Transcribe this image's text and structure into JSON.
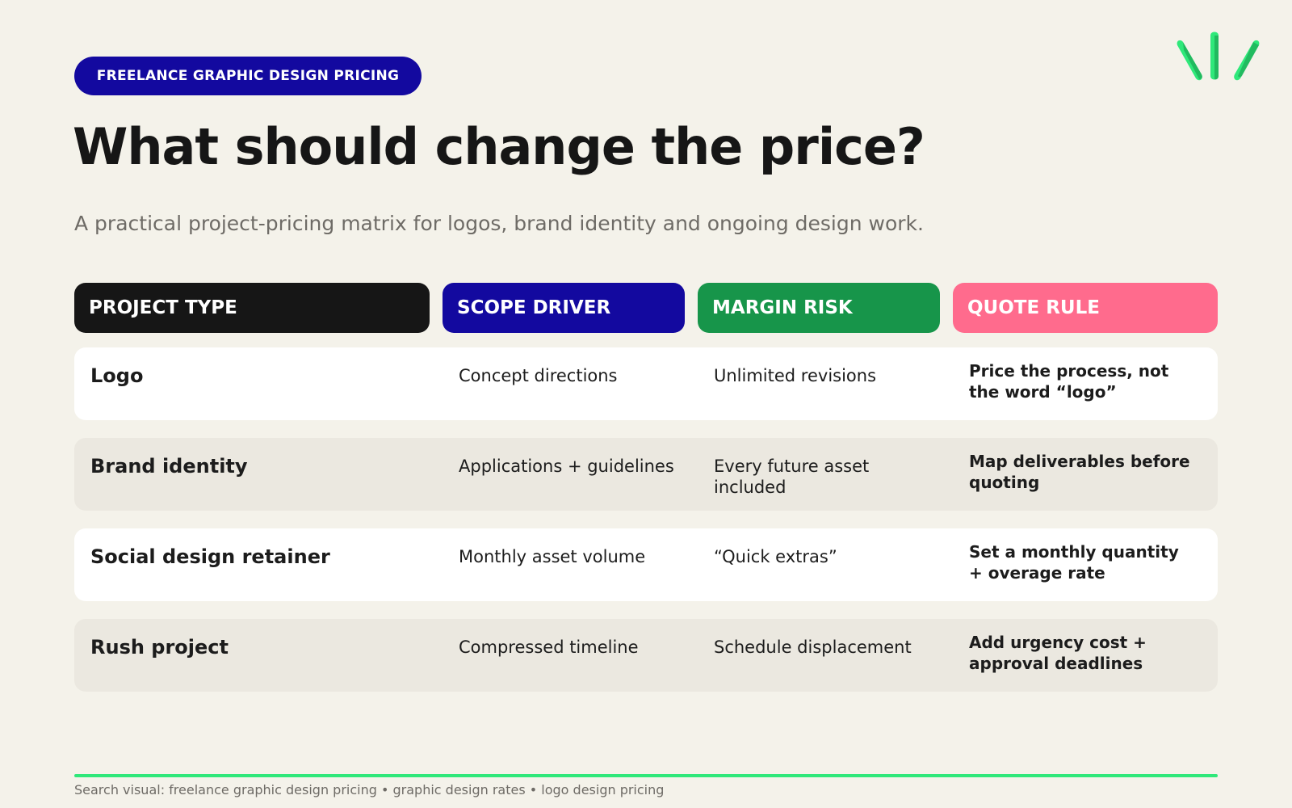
{
  "badge": "FREELANCE GRAPHIC DESIGN PRICING",
  "title": "What should change the price?",
  "subtitle": "A practical project-pricing matrix for logos, brand identity and ongoing design work.",
  "logo_icon": "leaf-sprout-icon",
  "colors": {
    "badge": "#13099f",
    "project_type": "#161616",
    "scope_driver": "#13099f",
    "margin_risk": "#17954a",
    "quote_rule": "#ff6b8d",
    "accent_line": "#2fe87a",
    "logo": "#2fe87a"
  },
  "table": {
    "headers": [
      "PROJECT TYPE",
      "SCOPE DRIVER",
      "MARGIN RISK",
      "QUOTE RULE"
    ],
    "rows": [
      {
        "type": "Logo",
        "scope": "Concept directions",
        "risk": "Unlimited revisions",
        "rule": "Price the process, not the word “logo”"
      },
      {
        "type": "Brand identity",
        "scope": "Applications + guidelines",
        "risk": "Every future asset included",
        "rule": "Map deliverables before quoting"
      },
      {
        "type": "Social design retainer",
        "scope": "Monthly asset volume",
        "risk": "“Quick extras”",
        "rule": "Set a monthly quantity + overage rate"
      },
      {
        "type": "Rush project",
        "scope": "Compressed timeline",
        "risk": "Schedule displacement",
        "rule": "Add urgency cost + approval deadlines"
      }
    ]
  },
  "footer": "Search visual: freelance graphic design pricing • graphic design rates • logo design pricing"
}
